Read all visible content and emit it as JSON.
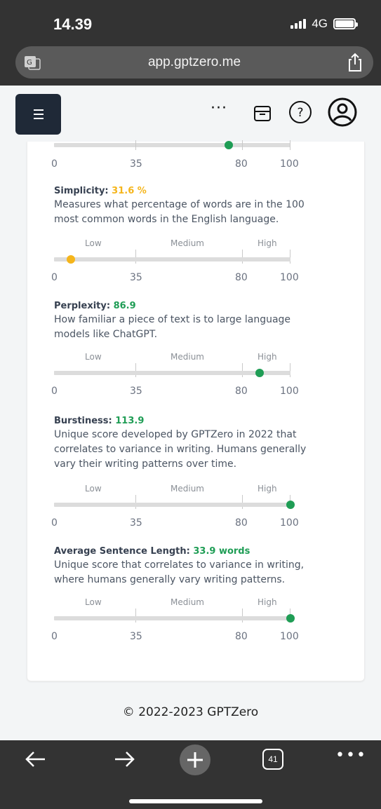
{
  "status": {
    "time": "14.39",
    "network": "4G"
  },
  "browser": {
    "url": "app.gptzero.me",
    "tab_count": "41"
  },
  "header": {
    "more_label": "···"
  },
  "scale_labels": {
    "low": "Low",
    "medium": "Medium",
    "high": "High"
  },
  "scale_numbers": [
    "0",
    "35",
    "80",
    "100"
  ],
  "metrics": [
    {
      "title": "Simplicity: ",
      "value": "31.6 %",
      "description": "Measures what percentage of words are in the 100 most common words in the English language.",
      "position": 7,
      "color": "#f5b51b"
    },
    {
      "title": "Perplexity: ",
      "value": "86.9",
      "description": "How familiar a piece of text is to large language models like ChatGPT.",
      "position": 86.9,
      "color": "#1f9d55"
    },
    {
      "title": "Burstiness: ",
      "value": "113.9",
      "description": "Unique score developed by GPTZero in 2022 that correlates to variance in writing. Humans generally vary their writing patterns over time.",
      "position": 100,
      "color": "#1f9d55"
    },
    {
      "title": "Average Sentence Length: ",
      "value": "33.9 words",
      "description": "Unique score that correlates to variance in writing, where humans generally vary writing patterns.",
      "position": 100,
      "color": "#1f9d55"
    }
  ],
  "top_partial_scale": {
    "position": 74,
    "color": "#1f9d55"
  },
  "footer": {
    "copyright": "© 2022-2023 GPTZero"
  }
}
